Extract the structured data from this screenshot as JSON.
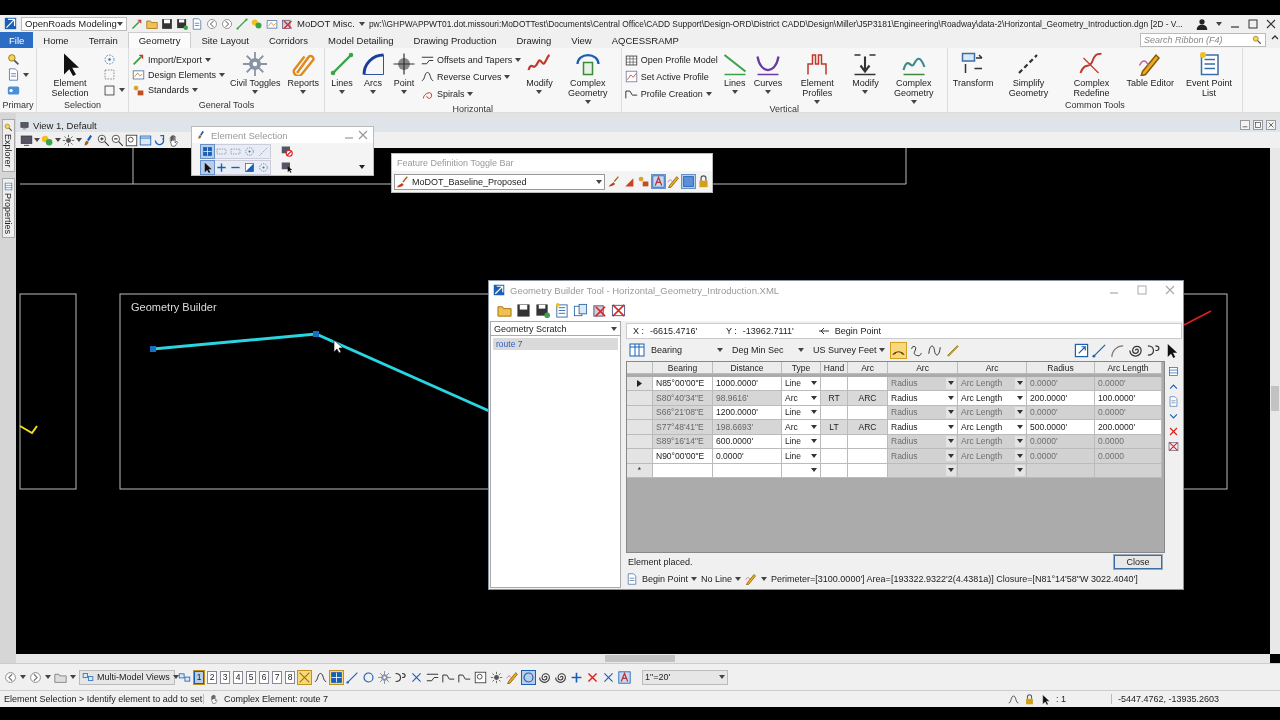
{
  "titlebar": {
    "workflow": "OpenRoads Modeling",
    "quick_access": "MoDOT Misc.",
    "file_path": "pw:\\\\GHPWAPPWT01.dot.missouri:MoDOTTest\\Documents\\Central Office\\CADD Support\\Design-ORD\\District CADD\\Design\\Miller\\J5P3181\\Engineering\\Roadway\\data-2\\Horizontal_Geometry_Introduction.dgn [2D - V..."
  },
  "tabs": [
    {
      "label": "File",
      "kind": "backstage",
      "selected": false
    },
    {
      "label": "Home",
      "kind": "tab",
      "selected": false
    },
    {
      "label": "Terrain",
      "kind": "tab",
      "selected": false
    },
    {
      "label": "Geometry",
      "kind": "tab",
      "selected": true
    },
    {
      "label": "Site Layout",
      "kind": "tab",
      "selected": false
    },
    {
      "label": "Corridors",
      "kind": "tab",
      "selected": false
    },
    {
      "label": "Model Detailing",
      "kind": "tab",
      "selected": false
    },
    {
      "label": "Drawing Production",
      "kind": "tab",
      "selected": false
    },
    {
      "label": "Drawing",
      "kind": "tab",
      "selected": false
    },
    {
      "label": "View",
      "kind": "tab",
      "selected": false
    },
    {
      "label": "AQCESSRAMP",
      "kind": "tab",
      "selected": false
    }
  ],
  "ribbon_search": {
    "placeholder": "Search Ribbon (F4)"
  },
  "ribbon_groups": [
    {
      "label": "Primary",
      "tools": [
        {
          "kind": "icon",
          "dropdown": false
        },
        {
          "kind": "icon",
          "dropdown": true
        },
        {
          "kind": "icon",
          "dropdown": false
        }
      ]
    },
    {
      "label": "Selection",
      "tools": [
        {
          "kind": "large",
          "label": "Element Selection",
          "dropdown": false
        },
        {
          "kind": "icon",
          "dropdown": false
        },
        {
          "kind": "icon",
          "dropdown": false
        },
        {
          "kind": "icon",
          "dropdown": true
        }
      ]
    },
    {
      "label": "General Tools",
      "tools": [
        {
          "kind": "small",
          "label": "Import/Export",
          "dropdown": true
        },
        {
          "kind": "small",
          "label": "Design Elements",
          "dropdown": true
        },
        {
          "kind": "small",
          "label": "Standards",
          "dropdown": true
        },
        {
          "kind": "large",
          "label": "Civil Toggles",
          "dropdown": true
        },
        {
          "kind": "large",
          "label": "Reports",
          "dropdown": true
        }
      ]
    },
    {
      "label": "Horizontal",
      "tools": [
        {
          "kind": "large",
          "label": "Lines",
          "dropdown": true
        },
        {
          "kind": "large",
          "label": "Arcs",
          "dropdown": true
        },
        {
          "kind": "large",
          "label": "Point",
          "dropdown": true
        },
        {
          "kind": "small",
          "label": "Offsets and Tapers",
          "dropdown": true
        },
        {
          "kind": "small",
          "label": "Reverse Curves",
          "dropdown": true
        },
        {
          "kind": "small",
          "label": "Spirals",
          "dropdown": true
        },
        {
          "kind": "large",
          "label": "Modify",
          "dropdown": true
        },
        {
          "kind": "large",
          "label": "Complex Geometry",
          "dropdown": true
        }
      ]
    },
    {
      "label": "Vertical",
      "tools": [
        {
          "kind": "small",
          "label": "Open Profile Model",
          "dropdown": false
        },
        {
          "kind": "small",
          "label": "Set Active Profile",
          "dropdown": false
        },
        {
          "kind": "small",
          "label": "Profile Creation",
          "dropdown": true
        },
        {
          "kind": "large",
          "label": "Lines",
          "dropdown": true
        },
        {
          "kind": "large",
          "label": "Curves",
          "dropdown": true
        },
        {
          "kind": "large",
          "label": "Element Profiles",
          "dropdown": true
        },
        {
          "kind": "large",
          "label": "Modify",
          "dropdown": true
        },
        {
          "kind": "large",
          "label": "Complex Geometry",
          "dropdown": true
        }
      ]
    },
    {
      "label": "Common Tools",
      "tools": [
        {
          "kind": "large",
          "label": "Transform",
          "dropdown": false
        },
        {
          "kind": "large",
          "label": "Simplify Geometry",
          "dropdown": false
        },
        {
          "kind": "large",
          "label": "Complex Redefine",
          "dropdown": false
        },
        {
          "kind": "large",
          "label": "Table Editor",
          "dropdown": false
        },
        {
          "kind": "large",
          "label": "Event Point List",
          "dropdown": false
        }
      ]
    }
  ],
  "side_tabs": [
    "Explorer",
    "Properties"
  ],
  "view": {
    "title": "View 1, Default",
    "canvas_label": "Geometry Builder"
  },
  "element_selection": {
    "title": "Element Selection",
    "methods": [
      {
        "selected": true
      },
      {
        "selected": false
      },
      {
        "selected": false
      },
      {
        "selected": false
      },
      {
        "selected": false
      }
    ],
    "modes": [
      {
        "selected": true
      },
      {
        "selected": false
      },
      {
        "selected": false
      },
      {
        "selected": false
      },
      {
        "selected": false
      }
    ]
  },
  "feature_bar": {
    "title": "Feature Definition Toggle Bar",
    "feature": "MoDOT_Baseline_Proposed",
    "toggles": [
      {
        "selected": false
      },
      {
        "selected": false
      },
      {
        "selected": false
      },
      {
        "selected": true
      },
      {
        "selected": false
      },
      {
        "selected": true
      },
      {
        "selected": false
      }
    ]
  },
  "geometry_builder": {
    "title": "Geometry Builder Tool - Horizontal_Geometry_Introduction.XML",
    "scratch": "Geometry Scratch",
    "items": [
      {
        "label": "route 7",
        "selected": true
      }
    ],
    "x_label": "X :",
    "x": "-6615.4716'",
    "y_label": "Y :",
    "y": "-13962.7111'",
    "point": "Begin Point",
    "direction": "Bearing",
    "angle": "Deg Min Sec",
    "units": "US Survey Feet",
    "mode_tools": [
      {
        "selected": true
      },
      {
        "selected": false
      },
      {
        "selected": false
      },
      {
        "selected": false
      }
    ],
    "columns": [
      "Bearing",
      "Distance",
      "Type",
      "Hand",
      "Arc",
      "Arc",
      "Arc",
      "Radius",
      "Arc Length"
    ],
    "rows": [
      {
        "current": true,
        "bearing": "N85°00'00\"E",
        "bearing_computed": false,
        "distance": "1000.0000'",
        "distance_computed": false,
        "type": "Line",
        "curve_enabled": false,
        "radius_mode": "Radius",
        "length_mode": "Arc Length",
        "radius": "0.0000'",
        "arc_length": "0.0000'"
      },
      {
        "current": false,
        "bearing": "S80°40'34\"E",
        "bearing_computed": true,
        "distance": "98.9616'",
        "distance_computed": true,
        "type": "Arc",
        "hand": "RT",
        "arc": "ARC",
        "curve_enabled": true,
        "radius_mode": "Radius",
        "length_mode": "Arc Length",
        "radius": "200.0000'",
        "arc_length": "100.0000'"
      },
      {
        "current": false,
        "bearing": "S66°21'08\"E",
        "bearing_computed": true,
        "distance": "1200.0000'",
        "distance_computed": false,
        "type": "Line",
        "curve_enabled": false,
        "radius_mode": "Radius",
        "length_mode": "Arc Length",
        "radius": "0.0000'",
        "arc_length": "0.0000'"
      },
      {
        "current": false,
        "bearing": "S77°48'41\"E",
        "bearing_computed": true,
        "distance": "198.6693'",
        "distance_computed": true,
        "type": "Arc",
        "hand": "LT",
        "arc": "ARC",
        "curve_enabled": true,
        "radius_mode": "Radius",
        "length_mode": "Arc Length",
        "radius": "500.0000'",
        "arc_length": "200.0000'"
      },
      {
        "current": false,
        "bearing": "S89°16'14\"E",
        "bearing_computed": true,
        "distance": "600.0000'",
        "distance_computed": false,
        "type": "Line",
        "curve_enabled": false,
        "radius_mode": "Radius",
        "length_mode": "Arc Length",
        "radius": "0.0000'",
        "arc_length": "0.0000"
      },
      {
        "current": false,
        "bearing": "N90°00'00\"E",
        "bearing_computed": false,
        "distance": "0.0000'",
        "distance_computed": false,
        "type": "Line",
        "curve_enabled": false,
        "radius_mode": "Radius",
        "length_mode": "Arc Length",
        "radius": "0.0000'",
        "arc_length": "0.0000"
      }
    ],
    "new_row_marker": "*",
    "message": "Element placed.",
    "close": "Close",
    "footer": {
      "point": "Begin Point",
      "line": "No Line",
      "summary": "Perimeter=[3100.0000'] Area=[193322.9322'2(4.4381a)] Closure=[N81°14'58\"W 3022.4040']"
    }
  },
  "bottom_toolbar": {
    "view_group": "Multi-Model Views",
    "views": [
      {
        "label": "1",
        "selected": true
      },
      {
        "label": "2",
        "selected": false
      },
      {
        "label": "3",
        "selected": false
      },
      {
        "label": "4",
        "selected": false
      },
      {
        "label": "5",
        "selected": false
      },
      {
        "label": "6",
        "selected": false
      },
      {
        "label": "7",
        "selected": false
      },
      {
        "label": "8",
        "selected": false
      }
    ],
    "snap_modes": [
      {
        "selected": true
      },
      {
        "selected": false
      },
      {
        "selected": true
      },
      {
        "selected": false
      },
      {
        "selected": false
      },
      {
        "selected": false
      },
      {
        "selected": false
      },
      {
        "selected": false
      },
      {
        "selected": false
      },
      {
        "selected": false
      },
      {
        "selected": false
      },
      {
        "selected": false
      }
    ],
    "display_modes": [
      {
        "selected": false
      },
      {
        "selected": false
      },
      {
        "selected": true
      },
      {
        "selected": false
      },
      {
        "selected": false
      },
      {
        "selected": false
      },
      {
        "selected": false
      },
      {
        "selected": false
      }
    ],
    "scale": "1\"=20'"
  },
  "status_bar": {
    "prompt": "Element Selection > Identify element to add to set",
    "message": "Complex Element: route 7",
    "count": ": 1",
    "coordinates": "-5447.4762, -13935.2603"
  }
}
